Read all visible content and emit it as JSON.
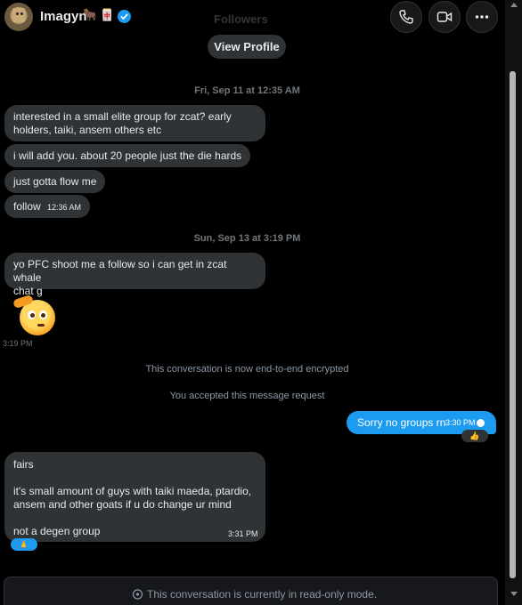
{
  "header": {
    "name": "Imagyn",
    "name_emojis": [
      "🐂",
      "🀄"
    ],
    "faded_label": "Followers",
    "icons": [
      "phone-icon",
      "video-icon",
      "more-icon"
    ]
  },
  "view_profile_label": "View Profile",
  "date_separators": [
    "Fri, Sep 11 at 12:35 AM",
    "Sun, Sep 13 at 3:19 PM"
  ],
  "messages": [
    {
      "lines": [
        "interested in a small elite group for zcat? early",
        "holders, taiki, ansem others etc"
      ]
    },
    {
      "text": "i will add you.  about 20 people just the die hards"
    },
    {
      "text": "just gotta flow me"
    },
    {
      "text": "follow",
      "time": "12:36 AM"
    },
    {
      "lines": [
        "yo PFC shoot me a follow so i can get in zcat whale",
        "chat g"
      ]
    }
  ],
  "sticker_time": "3:19 PM",
  "system_messages": [
    "This conversation is now end-to-end encrypted",
    "You accepted this message request"
  ],
  "outgoing": {
    "text": "Sorry no groups rn",
    "time": "3:30 PM",
    "reaction": "👍"
  },
  "incoming_long": {
    "lines": [
      "fairs",
      "it's small amount of guys with taiki maeda, ptardio,",
      "ansem and other goats if u do change ur mind",
      "not a degen group"
    ],
    "time": "3:31 PM",
    "reaction": "🙏"
  },
  "read_only_notice": "This conversation is currently in read-only mode.",
  "colors": {
    "background": "#000000",
    "incoming_bubble": "#2f3336",
    "outgoing_bubble": "#1d9bf0",
    "accent": "#1d9bf0"
  }
}
